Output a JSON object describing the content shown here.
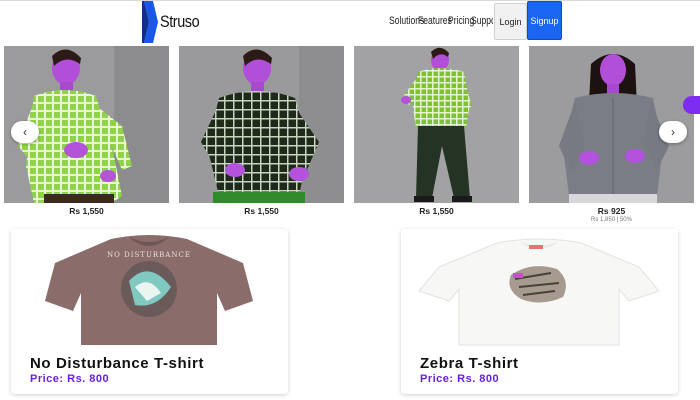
{
  "header": {
    "logo_text": "Struso",
    "nav_links": [
      "Solutions",
      "Features",
      "Pricing",
      "Support"
    ],
    "login_label": "Login",
    "signup_label": "Signup",
    "colors": {
      "signup_bg": "#1a66f0",
      "logo_blue": "#1a57e6"
    }
  },
  "carousel": {
    "prev_icon": "chevron-left-icon",
    "next_icon": "chevron-right-icon",
    "products": [
      {
        "price": "Rs 1,550",
        "subprice": ""
      },
      {
        "price": "Rs 1,550",
        "subprice": ""
      },
      {
        "price": "Rs 1,550",
        "subprice": ""
      },
      {
        "price": "Rs 925",
        "subprice": "Rs 1,850 | 50%"
      }
    ]
  },
  "featured": [
    {
      "name": "No Disturbance T-shirt",
      "price": "Price: Rs. 800",
      "print_text": "NO DISTURBANCE"
    },
    {
      "name": "Zebra T-shirt",
      "price": "Price: Rs. 800"
    }
  ],
  "colors": {
    "price_purple": "#6a1fe0",
    "accent_purple": "#7b2cf0"
  }
}
